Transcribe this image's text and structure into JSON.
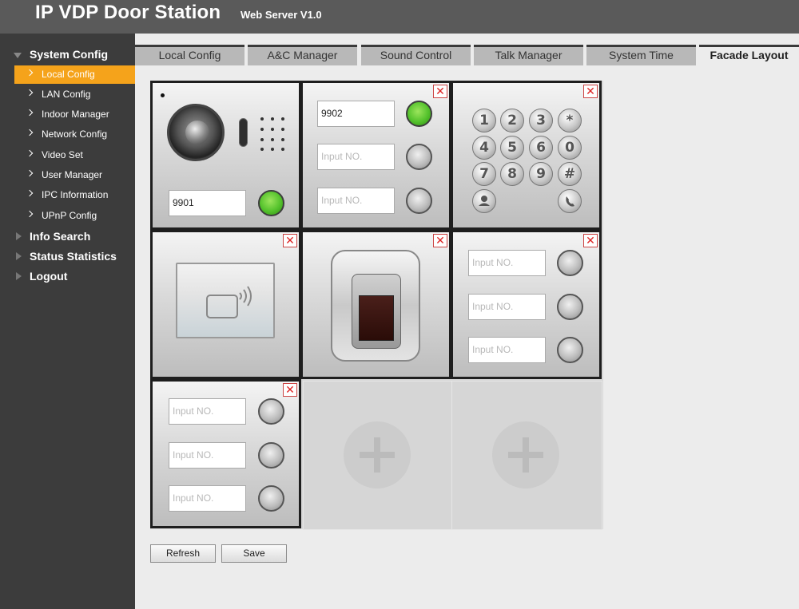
{
  "header": {
    "title": "IP VDP Door Station",
    "subtitle": "Web Server V1.0"
  },
  "sidebar": {
    "groups": [
      {
        "label": "System Config",
        "expanded": true,
        "items": [
          {
            "label": "Local Config",
            "active": true
          },
          {
            "label": "LAN Config"
          },
          {
            "label": "Indoor Manager"
          },
          {
            "label": "Network Config"
          },
          {
            "label": "Video Set"
          },
          {
            "label": "User Manager"
          },
          {
            "label": "IPC Information"
          },
          {
            "label": "UPnP Config"
          }
        ]
      },
      {
        "label": "Info Search",
        "expanded": false
      },
      {
        "label": "Status Statistics",
        "expanded": false
      },
      {
        "label": "Logout",
        "expanded": false
      }
    ]
  },
  "tabs": [
    {
      "label": "Local Config"
    },
    {
      "label": "A&C Manager"
    },
    {
      "label": "Sound Control"
    },
    {
      "label": "Talk Manager"
    },
    {
      "label": "System Time"
    },
    {
      "label": "Facade Layout",
      "active": true
    }
  ],
  "facade": {
    "close_symbol": "✕",
    "placeholder": "Input NO.",
    "camera_module": {
      "input_value": "9901",
      "button_color": "green"
    },
    "button_module_1": {
      "inputs": [
        "9902",
        "",
        ""
      ],
      "first_button_color": "green"
    },
    "keypad": {
      "keys": [
        "1",
        "2",
        "3",
        "*",
        "4",
        "5",
        "6",
        "0",
        "7",
        "8",
        "9",
        "#"
      ],
      "person_icon": "person-icon",
      "phone_icon": "phone-icon"
    },
    "card_reader": {
      "icon": "rfid-card-icon"
    },
    "fingerprint": {
      "icon": "fingerprint-sensor"
    },
    "button_module_2": {
      "inputs": [
        "",
        "",
        ""
      ]
    },
    "button_module_3": {
      "inputs": [
        "",
        "",
        ""
      ]
    },
    "add_slots": 2
  },
  "actions": {
    "refresh": "Refresh",
    "save": "Save"
  },
  "colors": {
    "accent": "#f5a31b",
    "sidebar_bg": "#3c3c3c",
    "header_bg": "#5a5a5a",
    "call_green": "#54c22c",
    "close_red": "#d22222"
  }
}
